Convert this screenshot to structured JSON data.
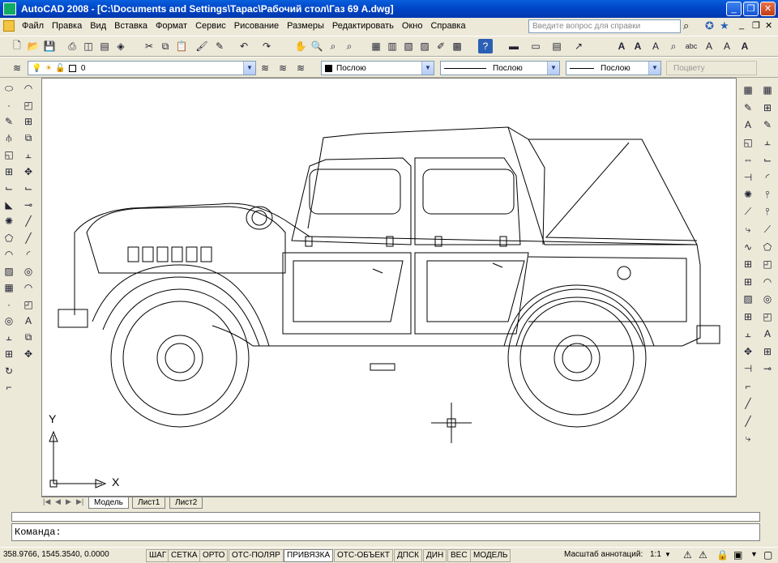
{
  "window": {
    "title": "AutoCAD 2008 - [C:\\Documents and Settings\\Тарас\\Рабочий стол\\Газ 69 А.dwg]"
  },
  "menu": [
    "Файл",
    "Правка",
    "Вид",
    "Вставка",
    "Формат",
    "Сервис",
    "Рисование",
    "Размеры",
    "Редактировать",
    "Окно",
    "Справка"
  ],
  "help": {
    "placeholder": "Введите вопрос для справки"
  },
  "layers": {
    "current": "0"
  },
  "properties": {
    "color": "Послою",
    "linetype": "Послою",
    "lineweight": "Послою",
    "plotstyle": "Поцвету"
  },
  "layout_tabs": [
    {
      "label": "Модель",
      "active": true
    },
    {
      "label": "Лист1",
      "active": false
    },
    {
      "label": "Лист2",
      "active": false
    }
  ],
  "ucs": {
    "x_label": "X",
    "y_label": "Y"
  },
  "command": {
    "prompt": "Команда:"
  },
  "status": {
    "coords": "358.9766, 1545.3540, 0.0000",
    "toggles": [
      {
        "label": "ШАГ",
        "on": false
      },
      {
        "label": "СЕТКА",
        "on": false
      },
      {
        "label": "ОРТО",
        "on": false
      },
      {
        "label": "ОТС-ПОЛЯР",
        "on": false
      },
      {
        "label": "ПРИВЯЗКА",
        "on": true
      },
      {
        "label": "ОТС-ОБЪЕКТ",
        "on": false
      },
      {
        "label": "ДПСК",
        "on": false
      },
      {
        "label": "ДИН",
        "on": false
      },
      {
        "label": "ВЕС",
        "on": false
      },
      {
        "label": "МОДЕЛЬ",
        "on": false
      }
    ],
    "annotation_scale_label": "Масштаб аннотаций:",
    "annotation_scale_value": "1:1"
  },
  "icons": {
    "draw": [
      "line-icon",
      "xline-icon",
      "polyline-icon",
      "polygon-icon",
      "rectangle-icon",
      "arc-icon",
      "circle-icon",
      "revcloud-icon",
      "spline-icon",
      "ellipse-icon",
      "ellipse-arc-icon",
      "insert-block-icon",
      "make-block-icon",
      "point-icon",
      "hatch-icon",
      "gradient-icon",
      "region-icon",
      "table-icon",
      "mtext-icon"
    ],
    "modify": [
      "erase-icon",
      "copy-icon",
      "mirror-icon",
      "offset-icon",
      "array-icon",
      "move-icon",
      "rotate-icon",
      "scale-icon",
      "stretch-icon",
      "trim-icon",
      "extend-icon",
      "break-at-point-icon",
      "break-icon",
      "join-icon",
      "chamfer-icon",
      "fillet-icon",
      "explode-icon"
    ],
    "dimension": [
      "dim-linear-icon",
      "dim-aligned-icon",
      "dim-arc-icon",
      "dim-ordinate-icon",
      "dim-radius-icon",
      "dim-jogged-icon",
      "dim-diameter-icon",
      "dim-angular-icon",
      "quick-dim-icon",
      "dim-baseline-icon",
      "dim-continue-icon",
      "dim-space-icon",
      "dim-break-icon",
      "tolerance-icon",
      "center-mark-icon",
      "inspection-icon",
      "jogged-linear-icon",
      "dim-edit-icon",
      "dim-text-edit-icon",
      "dim-update-icon",
      "dim-style-icon"
    ],
    "snap": [
      "temp-track-icon",
      "snap-from-icon",
      "endpoint-icon",
      "midpoint-icon",
      "intersection-icon",
      "apparent-intersection-icon",
      "extension-icon",
      "center-icon",
      "quadrant-icon",
      "tangent-icon",
      "perpendicular-icon",
      "parallel-icon",
      "insert-snap-icon",
      "node-icon",
      "nearest-icon",
      "none-snap-icon",
      "osnap-settings-icon"
    ]
  }
}
